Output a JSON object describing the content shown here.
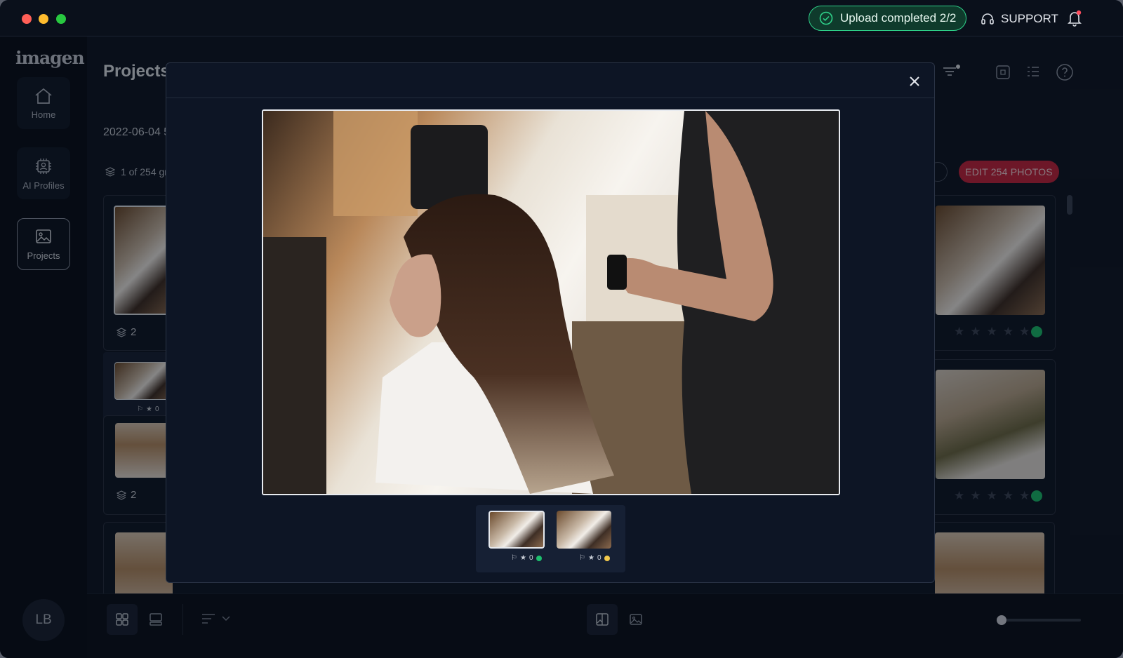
{
  "titlebar": {
    "upload_status": "Upload completed 2/2",
    "support_label": "SUPPORT"
  },
  "sidebar": {
    "logo": "imagen",
    "items": [
      {
        "label": "Home"
      },
      {
        "label": "AI Profiles"
      },
      {
        "label": "Projects"
      }
    ],
    "avatar_initials": "LB"
  },
  "page": {
    "title": "Projects",
    "project_date": "2022-06-04 5",
    "group_count": "1 of 254 gr",
    "edit_button": "EDIT 254 PHOTOS"
  },
  "grid": {
    "stack_counts": [
      "2",
      "2"
    ],
    "mini_rating": "0"
  },
  "viewer": {
    "thumbnails": [
      {
        "rating": "0",
        "status_color": "#1dbf6e"
      },
      {
        "rating": "0",
        "status_color": "#f2c94c"
      }
    ]
  },
  "colors": {
    "accent": "#c5253f",
    "success": "#1dbf6e",
    "warning": "#f2c94c"
  }
}
